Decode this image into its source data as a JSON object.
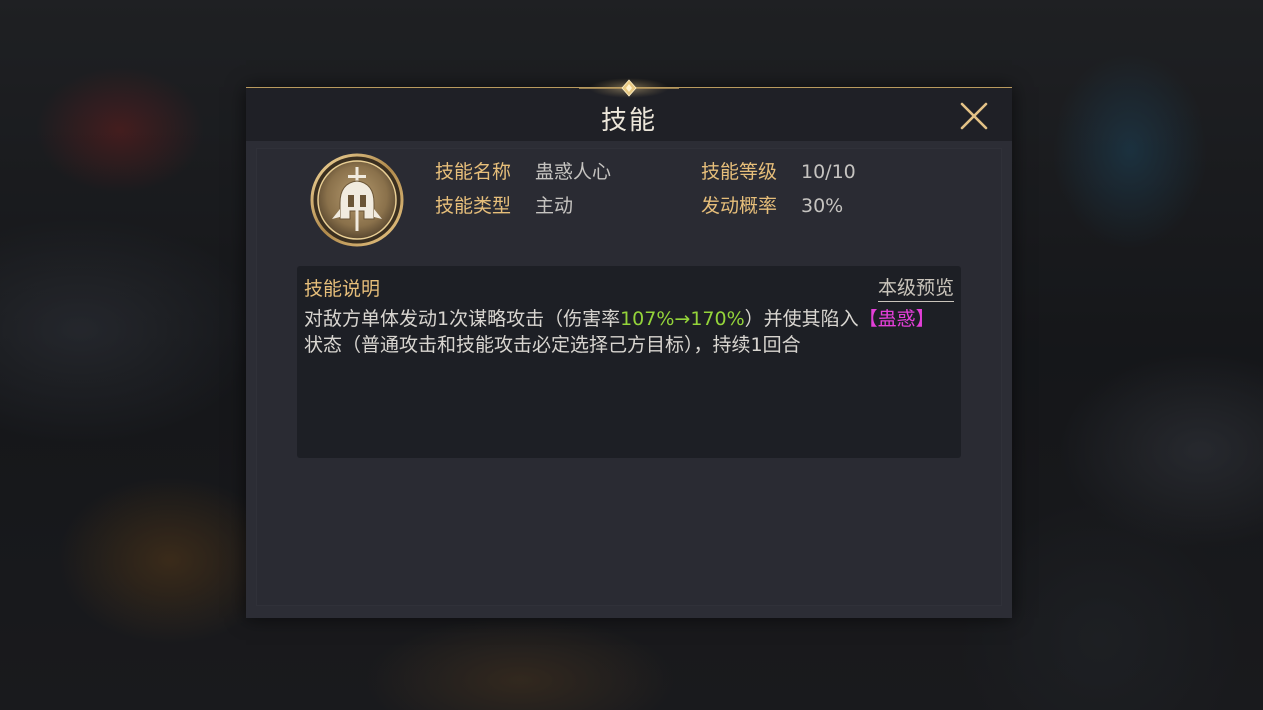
{
  "dialog": {
    "title": "技能",
    "close_icon": "close-icon"
  },
  "skill": {
    "icon": "helmet-sword-emblem-icon",
    "name_label": "技能名称",
    "name_value": "蛊惑人心",
    "level_label": "技能等级",
    "level_value": "10/10",
    "type_label": "技能类型",
    "type_value": "主动",
    "chance_label": "发动概率",
    "chance_value": "30%"
  },
  "description": {
    "title": "技能说明",
    "preview_link": "本级预览",
    "text_part1": "对敌方单体发动1次谋略攻击（伤害率",
    "damage_rate": "107%→170%",
    "text_part2": "）并使其陷入",
    "status_name": "【蛊惑】",
    "text_part3": "状态（普通攻击和技能攻击必定选择己方目标），持续1回合"
  },
  "colors": {
    "accent_gold": "#e6be7a",
    "highlight_green": "#94d43a",
    "highlight_pink": "#e33fd8",
    "panel_bg": "#2c2d35"
  }
}
